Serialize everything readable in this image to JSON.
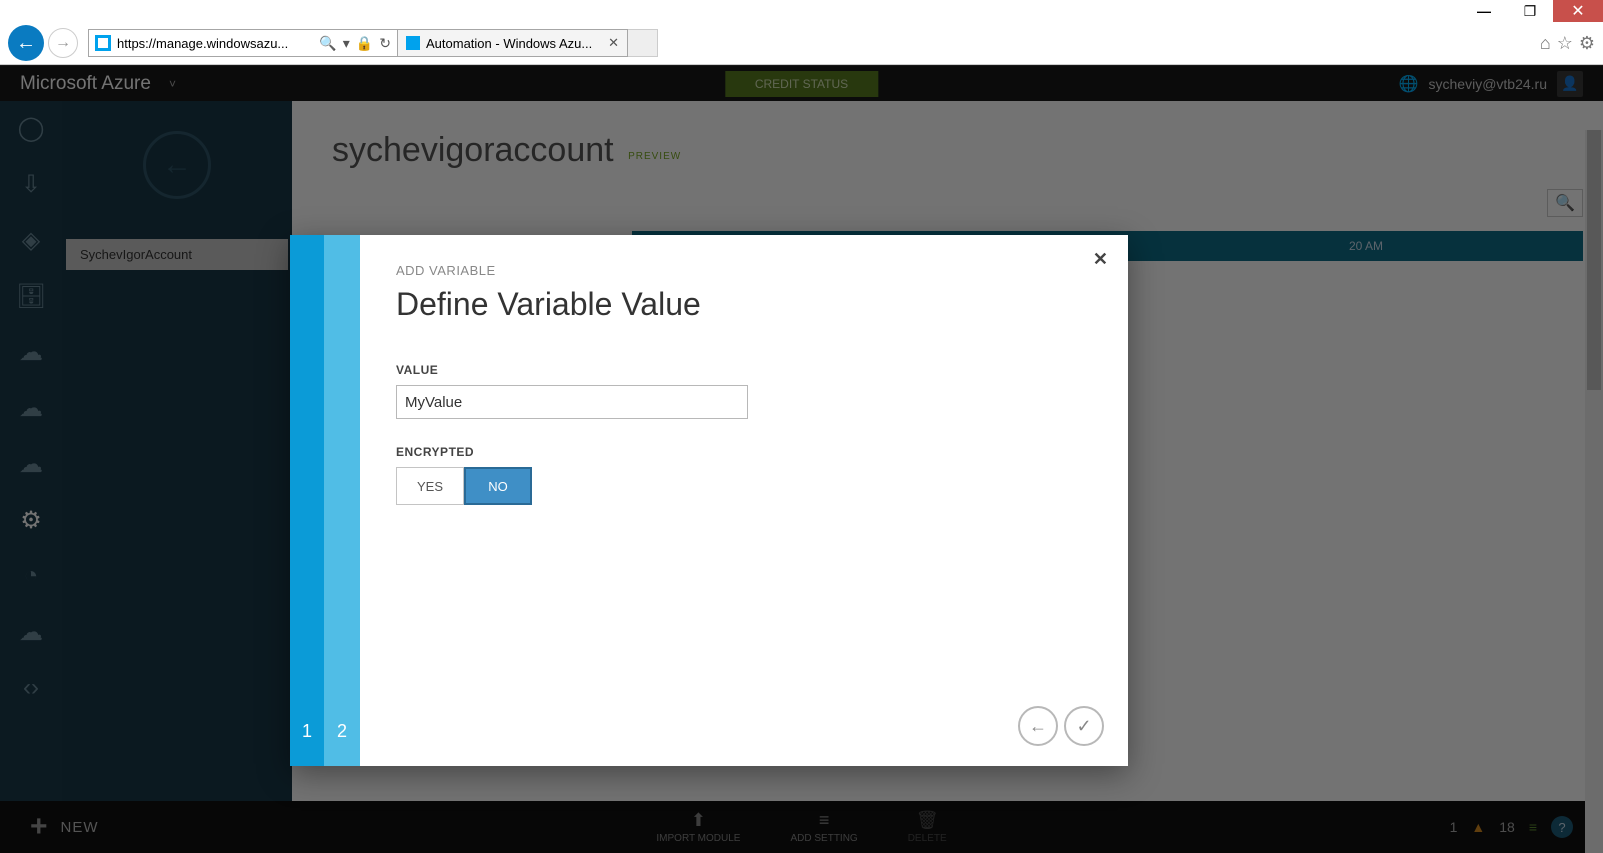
{
  "window": {
    "min": "—",
    "max": "❐",
    "close": "✕"
  },
  "browser": {
    "url": "https://manage.windowsazu...",
    "search_glyph": "🔍",
    "dropdown_glyph": "▾",
    "lock_glyph": "🔒",
    "refresh_glyph": "↻",
    "tab_title": "Automation - Windows Azu...",
    "tab_close": "✕",
    "home_glyph": "⌂",
    "star_glyph": "☆",
    "gear_glyph": "⚙"
  },
  "header": {
    "brand": "Microsoft Azure",
    "chevron": "˅",
    "credit": "CREDIT STATUS",
    "globe": "🌐",
    "user_email": "sycheviy@vtb24.ru",
    "avatar_glyph": "👤"
  },
  "sidebar": {
    "account_item": "SychevIgorAccount"
  },
  "content": {
    "title": "sychevigoraccount",
    "preview": "PREVIEW",
    "row_time": "20 AM",
    "search_glyph": "🔍"
  },
  "modal": {
    "eyebrow": "ADD VARIABLE",
    "title": "Define Variable Value",
    "close": "✕",
    "value_label": "VALUE",
    "value_input": "MyValue",
    "encrypted_label": "ENCRYPTED",
    "yes": "YES",
    "no": "NO",
    "step1": "1",
    "step2": "2",
    "back_glyph": "←",
    "ok_glyph": "✓"
  },
  "cmdbar": {
    "new_plus": "+",
    "new_label": "NEW",
    "import_glyph": "⬆",
    "import_label": "IMPORT MODULE",
    "add_glyph": "≡",
    "add_label": "ADD SETTING",
    "delete_glyph": "🗑",
    "delete_label": "DELETE",
    "count1": "1",
    "warn_glyph": "▲",
    "count2": "18",
    "bars_glyph": "≡",
    "help_glyph": "?"
  }
}
